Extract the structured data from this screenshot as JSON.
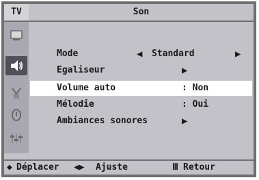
{
  "header": {
    "tv_label": "TV",
    "title": "Son"
  },
  "menu": {
    "items": [
      {
        "label": "Mode",
        "value": "Standard",
        "left_arrow": "◀",
        "right_arrow": "▶"
      },
      {
        "label": "Egaliseur",
        "arrow": "▶"
      },
      {
        "label": "Volume auto",
        "value": ": Non"
      },
      {
        "label": "Mélodie",
        "value": ": Oui"
      },
      {
        "label": "Ambiances sonores",
        "arrow": "▶"
      }
    ]
  },
  "sidebar": {
    "icons": [
      "picture-icon",
      "sound-icon",
      "channel-icon",
      "setup-icon",
      "input-icon"
    ],
    "active": "sound-icon"
  },
  "footer": {
    "move_glyph": "◆",
    "move_label": "Déplacer",
    "adjust_glyph": "◀▶",
    "adjust_label": "Ajuste",
    "return_glyph": "Ⅲ",
    "return_label": "Retour"
  },
  "colors": {
    "panel": "#c2c2c8",
    "sidebar": "#a8a8b0",
    "frame": "#6f6f6f",
    "selected": "#ffffff",
    "active_icon_bg": "#505058"
  }
}
